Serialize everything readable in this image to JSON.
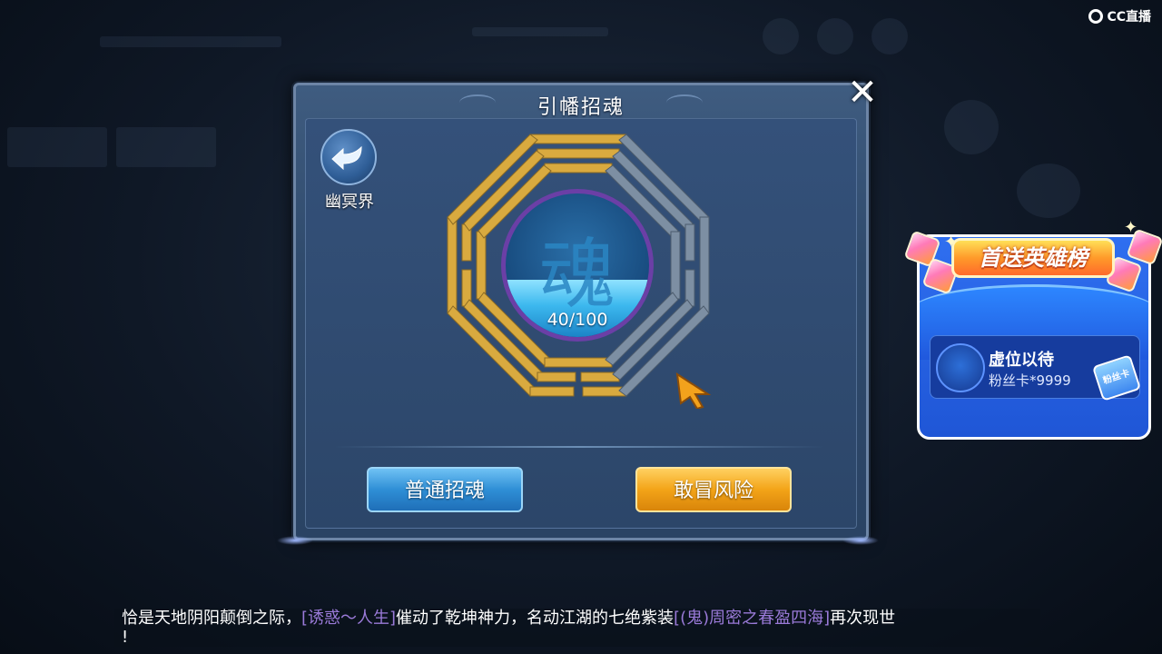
{
  "watermark": {
    "label": "CC直播"
  },
  "dialog": {
    "title": "引幡招魂",
    "close_symbol": "✕",
    "back_label": "幽冥界",
    "soul": {
      "glyph": "魂",
      "current": 40,
      "max": 100,
      "progress_text": "40/100"
    },
    "buttons": {
      "normal": "普通招魂",
      "risk": "敢冒风险"
    }
  },
  "rank_card": {
    "banner": "首送英雄榜",
    "entry_name": "虚位以待",
    "entry_sub": "粉丝卡*9999",
    "badge": "粉丝卡"
  },
  "caption": {
    "part1": "恰是天地阴阳颠倒之际，",
    "highlight1": "[诱惑～人生]",
    "part2": "催动了乾坤神力，名动江湖的七绝紫装",
    "highlight2": "[(鬼)周密之春盈四海]",
    "part3": "再次现世",
    "part4": "!"
  },
  "colors": {
    "bagua_gold": "#d9aa3f",
    "bagua_gray": "#7d8fa3",
    "soul_ring": "#6b3fa6",
    "highlight": "#9a7ad8"
  }
}
